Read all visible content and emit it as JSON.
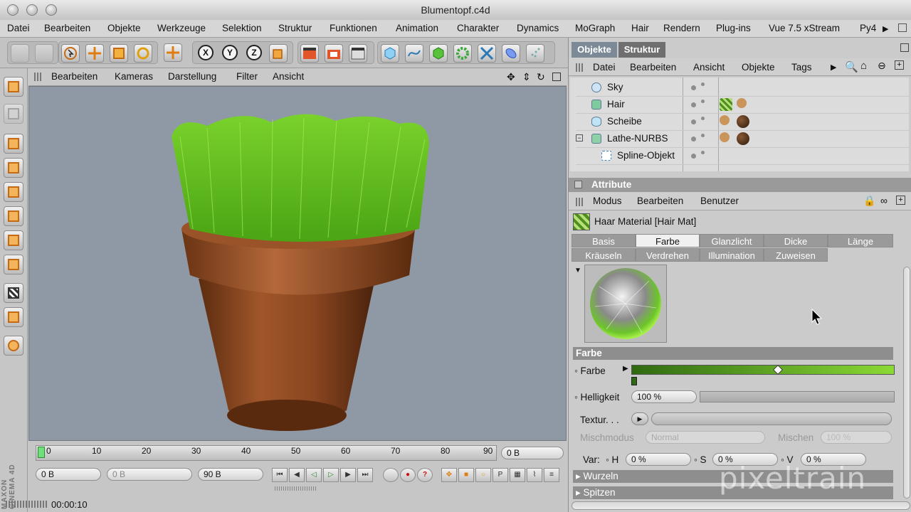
{
  "window": {
    "title": "Blumentopf.c4d"
  },
  "menubar": {
    "items": [
      "Datei",
      "Bearbeiten",
      "Objekte",
      "Werkzeuge",
      "Selektion",
      "Struktur",
      "Funktionen",
      "Animation",
      "Charakter",
      "Dynamics",
      "MoGraph",
      "Hair",
      "Rendern",
      "Plug-ins",
      "Vue 7.5 xStream",
      "Py4"
    ]
  },
  "toolbar": {
    "axis_x": "X",
    "axis_y": "Y",
    "axis_z": "Z"
  },
  "viewport": {
    "menu": [
      "Bearbeiten",
      "Kameras",
      "Darstellung",
      "Filter",
      "Ansicht"
    ]
  },
  "timeline": {
    "ticks": [
      "0",
      "10",
      "20",
      "30",
      "40",
      "50",
      "60",
      "70",
      "80",
      "90"
    ],
    "current_frame_field": "0 B",
    "start_field": "0 B",
    "min_field": "0 B",
    "end_field": "90 B",
    "time_readout": "00:00:10"
  },
  "objects_panel": {
    "tabs": [
      "Objekte",
      "Struktur"
    ],
    "menu": [
      "Datei",
      "Bearbeiten",
      "Ansicht",
      "Objekte",
      "Tags"
    ],
    "rows": [
      {
        "name": "Sky",
        "indent": 0
      },
      {
        "name": "Hair",
        "indent": 0
      },
      {
        "name": "Scheibe",
        "indent": 0
      },
      {
        "name": "Lathe-NURBS",
        "indent": 0
      },
      {
        "name": "Spline-Objekt",
        "indent": 1
      }
    ]
  },
  "attribute_panel": {
    "title": "Attribute",
    "menu": [
      "Modus",
      "Bearbeiten",
      "Benutzer"
    ],
    "material_name": "Haar Material [Hair Mat]",
    "tabs_row1": [
      "Basis",
      "Farbe",
      "Glanzlicht",
      "Dicke",
      "Länge"
    ],
    "tabs_row2": [
      "Kräuseln",
      "Verdrehen",
      "Illumination",
      "Zuweisen"
    ],
    "active_tab": "Farbe",
    "section_farbe": "Farbe",
    "farbe_label": "Farbe",
    "helligkeit_label": "Helligkeit",
    "helligkeit_value": "100 %",
    "textur_label": "Textur. . .",
    "mischmodus_label": "Mischmodus",
    "mischmodus_value": "Normal",
    "mischen_label": "Mischen",
    "mischen_value": "100 %",
    "var_label": "Var:",
    "var_h_label": "H",
    "var_h_value": "0 %",
    "var_s_label": "S",
    "var_s_value": "0 %",
    "var_v_label": "V",
    "var_v_value": "0 %",
    "collapsed_sections": [
      "Wurzeln",
      "Spitzen"
    ]
  },
  "brand": {
    "side_label": "MAXON CINEMA 4D",
    "watermark": "pixeltrain"
  },
  "colors": {
    "grass": "#7ad22b",
    "pot": "#8d4b24",
    "viewport_bg": "#8f99a5",
    "gradient_start": "#2f6a12",
    "gradient_end": "#8bd936"
  }
}
